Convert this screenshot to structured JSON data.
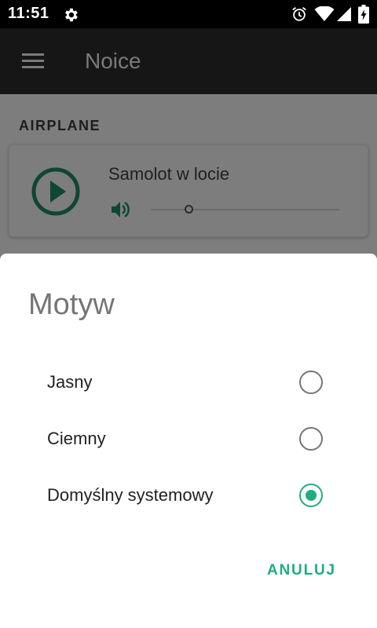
{
  "status_bar": {
    "time": "11:51",
    "icons": [
      "settings-gear-icon",
      "alarm-icon",
      "wifi-icon",
      "signal-icon",
      "battery-charging-icon"
    ]
  },
  "toolbar": {
    "title": "Noice",
    "menu_icon": "hamburger-menu-icon"
  },
  "main": {
    "section_title": "AIRPLANE",
    "card": {
      "sound_name": "Samolot w locie",
      "play_icon": "play-icon",
      "volume_icon": "volume-icon",
      "volume_level": 0.2
    }
  },
  "dialog": {
    "title": "Motyw",
    "options": [
      {
        "label": "Jasny",
        "selected": false
      },
      {
        "label": "Ciemny",
        "selected": false
      },
      {
        "label": "Domyślny systemowy",
        "selected": true
      }
    ],
    "cancel_label": "ANULUJ"
  },
  "colors": {
    "accent": "#1fae7e",
    "scrim": "#7d7d7d",
    "toolbar": "#161616"
  }
}
